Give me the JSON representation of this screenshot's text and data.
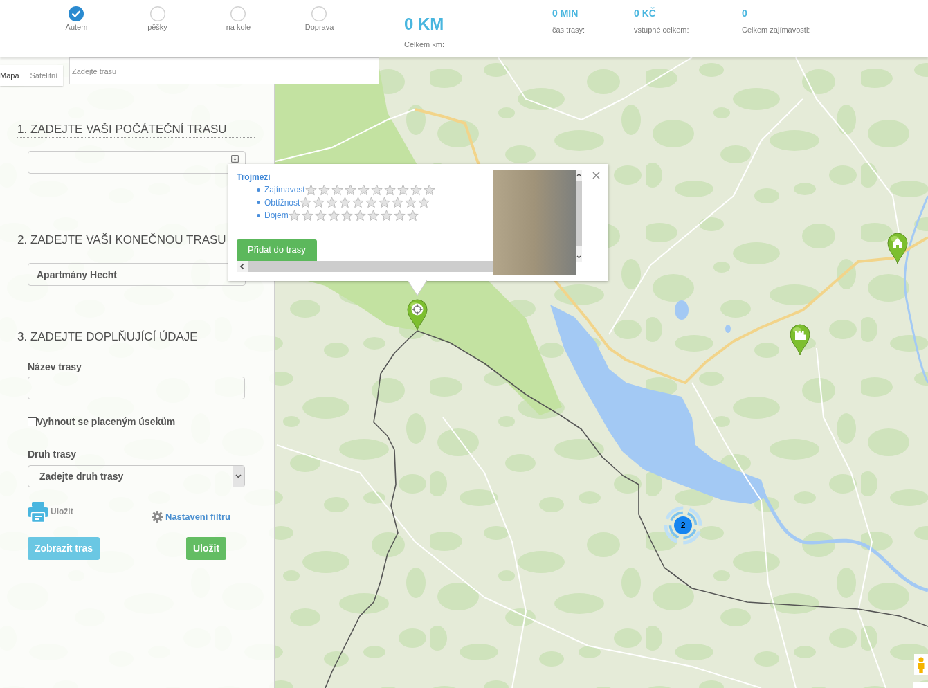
{
  "transport_modes": [
    {
      "label": "Autem",
      "selected": true
    },
    {
      "label": "pěšky",
      "selected": false
    },
    {
      "label": "na kole",
      "selected": false
    },
    {
      "label": "Doprava",
      "selected": false
    }
  ],
  "totals": [
    {
      "kind": "large",
      "value": "0 KM",
      "label": "Celkem km:"
    },
    {
      "kind": "small",
      "value": "0 MIN",
      "label": "čas trasy:"
    },
    {
      "kind": "small",
      "value": "0 KČ",
      "label": "vstupné celkem:"
    },
    {
      "kind": "small",
      "value": "0",
      "label": "Celkem zajímavosti:"
    }
  ],
  "map": {
    "type_buttons": [
      {
        "label": "Mapa",
        "selected": true
      },
      {
        "label": "Satelitní",
        "selected": false
      }
    ],
    "search": {
      "placeholder": "Zadejte trasu"
    }
  },
  "panel": {
    "start": {
      "heading": "1. ZADEJTE VAŠI POČÁTEČNÍ TRASU"
    },
    "end": {
      "heading": "2. ZADEJTE VAŠI KONEČNOU TRASU",
      "value": "Apartmány Hecht"
    },
    "details": {
      "heading": "3. ZADEJTE DOPLŇUJÍCÍ ÚDAJE",
      "name_label": "Název trasy",
      "avoid_tolls": {
        "label": "Vyhnout se placeným úsekům",
        "checked": false
      },
      "type_label": "Druh trasy",
      "type_value": "Zadejte druh trasy",
      "print_label": "Uložit",
      "filter_link": "Nastavení filtru",
      "buttons": [
        {
          "kind": "info",
          "label": "Zobrazit tras"
        },
        {
          "kind": "success",
          "label": "Uložit"
        }
      ]
    }
  },
  "popup": {
    "title": "Trojmezí",
    "ratings": [
      {
        "label": "Zajímavost",
        "stars": 0
      },
      {
        "label": "Obtížnost",
        "stars": 0
      },
      {
        "label": "Dojem",
        "stars": 0
      }
    ],
    "button": "Přidat do trasy"
  },
  "cluster": {
    "count": "2"
  }
}
